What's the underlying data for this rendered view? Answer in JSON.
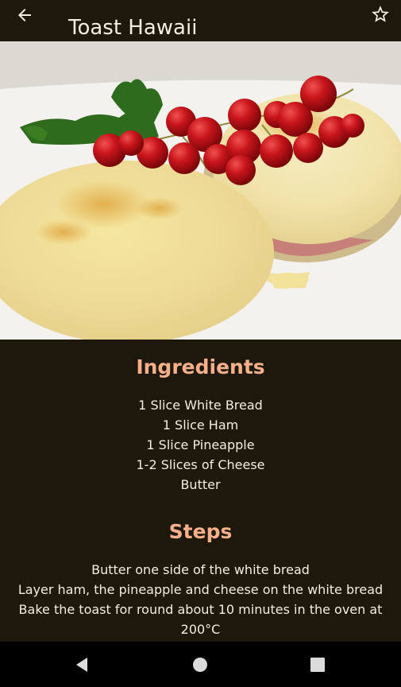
{
  "app_bar": {
    "title": "Toast Hawaii",
    "back_icon": "arrow-left-icon",
    "favorite_icon": "star-outline-icon"
  },
  "hero_image": {
    "subject": "toast-hawaii-photo"
  },
  "ingredients": {
    "heading": "Ingredients",
    "items": [
      "1 Slice White Bread",
      "1 Slice Ham",
      "1 Slice Pineapple",
      "1-2 Slices of Cheese",
      "Butter"
    ]
  },
  "steps": {
    "heading": "Steps",
    "items": [
      "Butter one side of the white bread",
      "Layer ham, the pineapple and cheese on the white bread",
      "Bake the toast for round about 10 minutes in the oven at 200°C"
    ]
  },
  "system_nav": {
    "back_icon": "triangle-back-icon",
    "home_icon": "circle-home-icon",
    "recents_icon": "square-recents-icon"
  },
  "colors": {
    "background": "#1e170b",
    "accent": "#f5b08a",
    "text": "#f3ede2",
    "nav_bar": "#000000"
  }
}
